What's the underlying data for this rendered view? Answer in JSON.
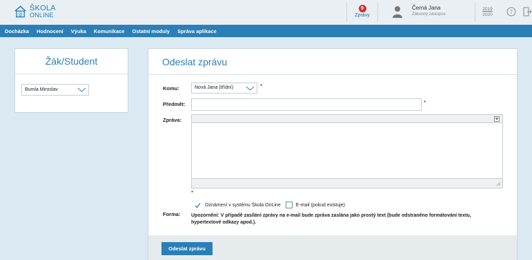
{
  "app": {
    "logo_line1": "ŠKOLA",
    "logo_line2": "ONLINE",
    "messages_count": "9",
    "messages_label": "Zprávy",
    "user_name": "Černá Jana",
    "user_role": "Zákonný zástupce",
    "year_line1": "2019",
    "year_line2": "2020"
  },
  "nav": {
    "items": [
      "Docházka",
      "Hodnocení",
      "Výuka",
      "Komunikace",
      "Ostatní moduly",
      "Správa aplikace"
    ]
  },
  "student_panel": {
    "title": "Žák/Student",
    "selected_student": "Bumla Miroslav"
  },
  "compose": {
    "title": "Odeslat zprávu",
    "to_label": "Komu:",
    "to_value": "Nová Jana (třídní)",
    "subject_label": "Předmět:",
    "subject_value": "",
    "message_label": "Zpráva:",
    "required_mark": "*",
    "form_label": "Forma:",
    "notify_option": "Oznámení v systému Škola OnLine",
    "notify_checked": true,
    "email_option": "E-mail (pokud existuje)",
    "email_checked": false,
    "warning_bold": "Upozornění: V případě zasílání zprávy na e-mail bude zpráva zaslána jako prostý text (bude odstraněno formátování textu, hypertextové odkazy apod.).",
    "send_button": "Odeslat zprávu"
  },
  "colors": {
    "brand_blue": "#2b7fb8",
    "badge_red": "#d0312d",
    "background": "#dbe9f3"
  },
  "icons": [
    "home-at-icon",
    "user-icon",
    "help-icon",
    "logout-icon",
    "chevron-down-icon",
    "check-icon",
    "resize-handle-icon"
  ]
}
